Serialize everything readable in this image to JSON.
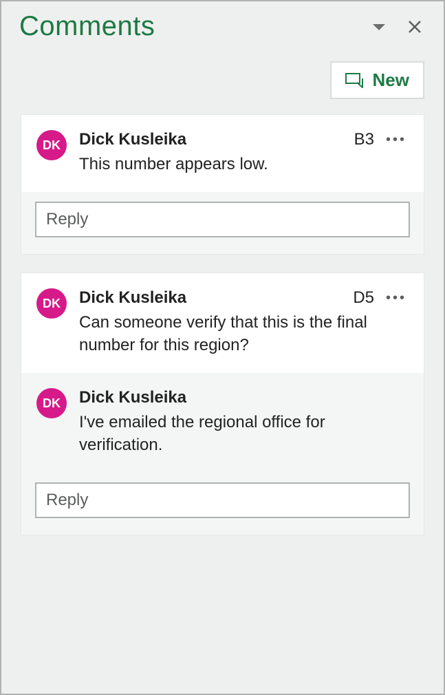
{
  "panel": {
    "title": "Comments",
    "new_label": "New",
    "reply_placeholder": "Reply"
  },
  "threads": [
    {
      "cell": "B3",
      "comments": [
        {
          "initials": "DK",
          "author": "Dick Kusleika",
          "text": "This number appears low."
        }
      ]
    },
    {
      "cell": "D5",
      "comments": [
        {
          "initials": "DK",
          "author": "Dick Kusleika",
          "text": "Can someone verify that this is the final number for this region?"
        },
        {
          "initials": "DK",
          "author": "Dick Kusleika",
          "text": "I've emailed the regional office for verification."
        }
      ]
    }
  ]
}
